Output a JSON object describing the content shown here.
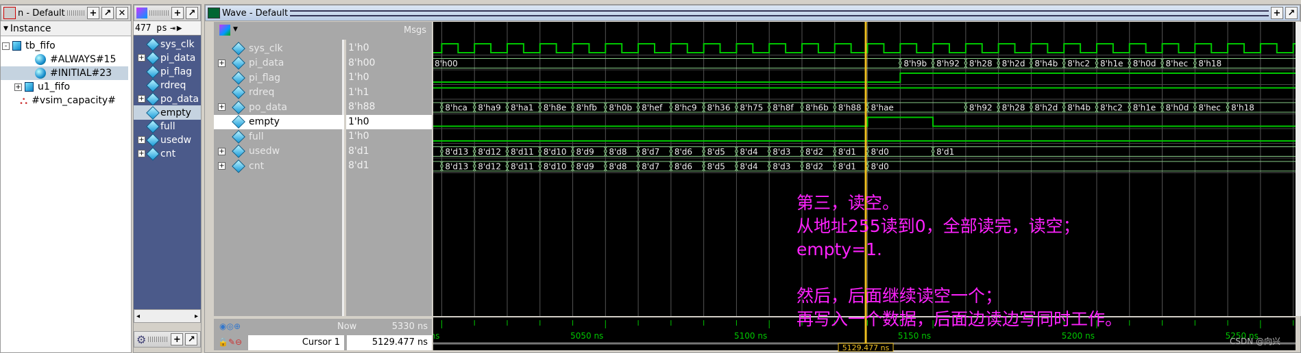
{
  "instance_panel": {
    "title": "n - Default",
    "column": "Instance",
    "tree": [
      {
        "label": "tb_fifo",
        "icon": "module-icon",
        "expander": "-"
      },
      {
        "label": "#ALWAYS#15",
        "icon": "process-icon"
      },
      {
        "label": "#INITIAL#23",
        "icon": "process-icon",
        "selected": true
      },
      {
        "label": "u1_fifo",
        "icon": "module-icon",
        "expander": "+"
      },
      {
        "label": "#vsim_capacity#",
        "icon": "capacity-icon"
      }
    ]
  },
  "objects_panel": {
    "time": "477 ps",
    "signals": [
      {
        "label": "sys_clk"
      },
      {
        "label": "pi_data",
        "expander": "+"
      },
      {
        "label": "pi_flag"
      },
      {
        "label": "rdreq"
      },
      {
        "label": "po_data",
        "expander": "+"
      },
      {
        "label": "empty",
        "selected": true
      },
      {
        "label": "full"
      },
      {
        "label": "usedw",
        "expander": "+"
      },
      {
        "label": "cnt",
        "expander": "+"
      }
    ]
  },
  "wave": {
    "title": "Wave - Default",
    "msgs_header": "Msgs",
    "signals": [
      {
        "name": "sys_clk",
        "value": "1'h0",
        "type": "clock",
        "period": 10,
        "first_rise": 5000
      },
      {
        "name": "pi_data",
        "value": "8'h00",
        "type": "bus",
        "expander": "+",
        "segments": [
          [
            4990,
            "8'h00"
          ],
          [
            5140,
            "8'h9b"
          ],
          [
            5150,
            "8'h92"
          ],
          [
            5160,
            "8'h28"
          ],
          [
            5170,
            "8'h2d"
          ],
          [
            5180,
            "8'h4b"
          ],
          [
            5190,
            "8'hc2"
          ],
          [
            5200,
            "8'h1e"
          ],
          [
            5210,
            "8'h0d"
          ],
          [
            5220,
            "8'hec"
          ],
          [
            5230,
            "8'h18"
          ]
        ]
      },
      {
        "name": "pi_flag",
        "value": "1'h0",
        "type": "bit",
        "edges": [
          [
            4990,
            0
          ],
          [
            5140,
            1
          ]
        ]
      },
      {
        "name": "rdreq",
        "value": "1'h1",
        "type": "bit",
        "edges": [
          [
            4990,
            1
          ]
        ]
      },
      {
        "name": "po_data",
        "value": "8'h88",
        "type": "bus",
        "expander": "+",
        "segments": [
          [
            5000,
            "8'hca"
          ],
          [
            5010,
            "8'ha9"
          ],
          [
            5020,
            "8'ha1"
          ],
          [
            5030,
            "8'h8e"
          ],
          [
            5040,
            "8'hfb"
          ],
          [
            5050,
            "8'h0b"
          ],
          [
            5060,
            "8'hef"
          ],
          [
            5070,
            "8'hc9"
          ],
          [
            5080,
            "8'h36"
          ],
          [
            5090,
            "8'h75"
          ],
          [
            5100,
            "8'h8f"
          ],
          [
            5110,
            "8'h6b"
          ],
          [
            5120,
            "8'h88"
          ],
          [
            5130,
            "8'hae"
          ],
          [
            5160,
            "8'h92"
          ],
          [
            5170,
            "8'h28"
          ],
          [
            5180,
            "8'h2d"
          ],
          [
            5190,
            "8'h4b"
          ],
          [
            5200,
            "8'hc2"
          ],
          [
            5210,
            "8'h1e"
          ],
          [
            5220,
            "8'h0d"
          ],
          [
            5230,
            "8'hec"
          ],
          [
            5240,
            "8'h18"
          ]
        ]
      },
      {
        "name": "empty",
        "value": "1'h0",
        "type": "bit",
        "selected": true,
        "edges": [
          [
            4990,
            0
          ],
          [
            5130,
            1
          ],
          [
            5150,
            0
          ]
        ]
      },
      {
        "name": "full",
        "value": "1'h0",
        "type": "bit",
        "edges": [
          [
            4990,
            0
          ]
        ]
      },
      {
        "name": "usedw",
        "value": "8'd1",
        "type": "bus",
        "expander": "+",
        "segments": [
          [
            5000,
            "8'd13"
          ],
          [
            5010,
            "8'd12"
          ],
          [
            5020,
            "8'd11"
          ],
          [
            5030,
            "8'd10"
          ],
          [
            5040,
            "8'd9"
          ],
          [
            5050,
            "8'd8"
          ],
          [
            5060,
            "8'd7"
          ],
          [
            5070,
            "8'd6"
          ],
          [
            5080,
            "8'd5"
          ],
          [
            5090,
            "8'd4"
          ],
          [
            5100,
            "8'd3"
          ],
          [
            5110,
            "8'd2"
          ],
          [
            5120,
            "8'd1"
          ],
          [
            5130,
            "8'd0"
          ],
          [
            5150,
            "8'd1"
          ]
        ]
      },
      {
        "name": "cnt",
        "value": "8'd1",
        "type": "bus",
        "expander": "+",
        "segments": [
          [
            5000,
            "8'd13"
          ],
          [
            5010,
            "8'd12"
          ],
          [
            5020,
            "8'd11"
          ],
          [
            5030,
            "8'd10"
          ],
          [
            5040,
            "8'd9"
          ],
          [
            5050,
            "8'd8"
          ],
          [
            5060,
            "8'd7"
          ],
          [
            5070,
            "8'd6"
          ],
          [
            5080,
            "8'd5"
          ],
          [
            5090,
            "8'd4"
          ],
          [
            5100,
            "8'd3"
          ],
          [
            5110,
            "8'd2"
          ],
          [
            5120,
            "8'd1"
          ],
          [
            5130,
            "8'd0"
          ]
        ]
      }
    ],
    "time_axis": {
      "labels": [
        5000,
        5050,
        5100,
        5150,
        5200,
        5250
      ],
      "unit": "ns",
      "view_start": 4997.4,
      "view_end": 5260.7
    },
    "now_label": "Now",
    "now_value": "5330 ns",
    "cursor_label": "Cursor 1",
    "cursor_value": "5129.477 ns",
    "cursor_time": 5129.477,
    "colors": {
      "wave": "#00c800",
      "cursor": "#f0c020",
      "annotation": "#ff22ff",
      "background": "#000000"
    }
  },
  "annotation": {
    "lines": [
      "第三，读空。",
      "从地址255读到0，全部读完，读空；",
      "empty=1.",
      "",
      "然后，后面继续读空一个；",
      "再写入一个数据，后面边读边写同时工作。"
    ]
  },
  "watermark": "CSDN @向兴"
}
